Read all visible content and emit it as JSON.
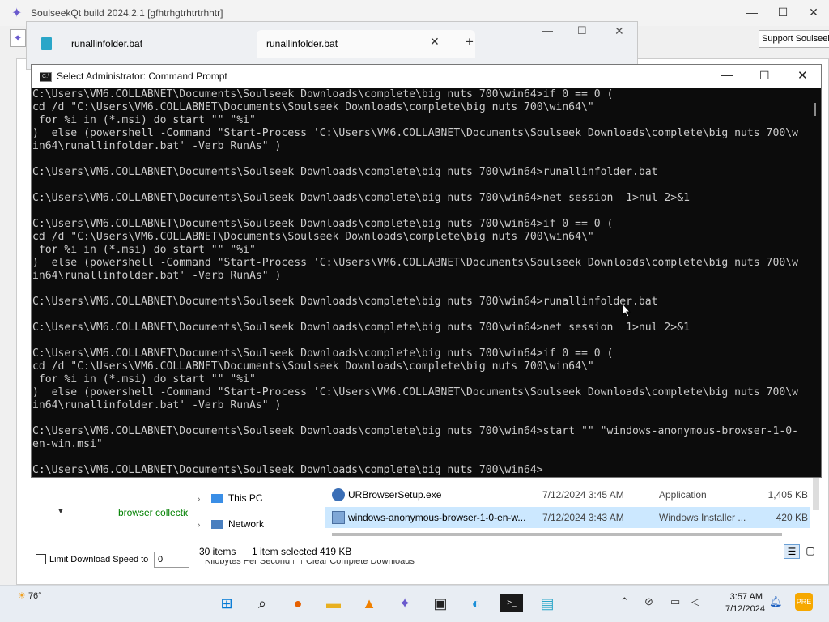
{
  "soulseek": {
    "title": "SoulseekQt build 2024.2.1 [gfhtrhgtrhtrtrhhtr]",
    "support_button": "Support Soulseek",
    "browser_collection": "browser collection",
    "limit_download_label": "Limit Download Speed to",
    "speed_value": "0",
    "kbps_label": "Kilobytes Per Second",
    "clear_complete_label": "Clear Complete Downloads"
  },
  "notepad": {
    "tab1": "runallinfolder.bat",
    "tab2": "runallinfolder.bat"
  },
  "cmd": {
    "title": "Select Administrator: Command Prompt",
    "lines": [
      "C:\\Users\\VM6.COLLABNET\\Documents\\Soulseek Downloads\\complete\\big nuts 700\\win64>if 0 == 0 (",
      "cd /d \"C:\\Users\\VM6.COLLABNET\\Documents\\Soulseek Downloads\\complete\\big nuts 700\\win64\\\"",
      " for %i in (*.msi) do start \"\" \"%i\"",
      ")  else (powershell -Command \"Start-Process 'C:\\Users\\VM6.COLLABNET\\Documents\\Soulseek Downloads\\complete\\big nuts 700\\w",
      "in64\\runallinfolder.bat' -Verb RunAs\" )",
      "",
      "C:\\Users\\VM6.COLLABNET\\Documents\\Soulseek Downloads\\complete\\big nuts 700\\win64>runallinfolder.bat",
      "",
      "C:\\Users\\VM6.COLLABNET\\Documents\\Soulseek Downloads\\complete\\big nuts 700\\win64>net session  1>nul 2>&1",
      "",
      "C:\\Users\\VM6.COLLABNET\\Documents\\Soulseek Downloads\\complete\\big nuts 700\\win64>if 0 == 0 (",
      "cd /d \"C:\\Users\\VM6.COLLABNET\\Documents\\Soulseek Downloads\\complete\\big nuts 700\\win64\\\"",
      " for %i in (*.msi) do start \"\" \"%i\"",
      ")  else (powershell -Command \"Start-Process 'C:\\Users\\VM6.COLLABNET\\Documents\\Soulseek Downloads\\complete\\big nuts 700\\w",
      "in64\\runallinfolder.bat' -Verb RunAs\" )",
      "",
      "C:\\Users\\VM6.COLLABNET\\Documents\\Soulseek Downloads\\complete\\big nuts 700\\win64>runallinfolder.bat",
      "",
      "C:\\Users\\VM6.COLLABNET\\Documents\\Soulseek Downloads\\complete\\big nuts 700\\win64>net session  1>nul 2>&1",
      "",
      "C:\\Users\\VM6.COLLABNET\\Documents\\Soulseek Downloads\\complete\\big nuts 700\\win64>if 0 == 0 (",
      "cd /d \"C:\\Users\\VM6.COLLABNET\\Documents\\Soulseek Downloads\\complete\\big nuts 700\\win64\\\"",
      " for %i in (*.msi) do start \"\" \"%i\"",
      ")  else (powershell -Command \"Start-Process 'C:\\Users\\VM6.COLLABNET\\Documents\\Soulseek Downloads\\complete\\big nuts 700\\w",
      "in64\\runallinfolder.bat' -Verb RunAs\" )",
      "",
      "C:\\Users\\VM6.COLLABNET\\Documents\\Soulseek Downloads\\complete\\big nuts 700\\win64>start \"\" \"windows-anonymous-browser-1-0-",
      "en-win.msi\"",
      "",
      "C:\\Users\\VM6.COLLABNET\\Documents\\Soulseek Downloads\\complete\\big nuts 700\\win64>"
    ]
  },
  "explorer": {
    "nav": [
      {
        "label": "This PC",
        "icon": "computer-icon"
      },
      {
        "label": "Network",
        "icon": "network-icon"
      }
    ],
    "files": [
      {
        "name": "URBrowserSetup.exe",
        "date": "7/12/2024 3:45 AM",
        "type": "Application",
        "size": "1,405 KB",
        "icon": "exe-file-icon"
      },
      {
        "name": "windows-anonymous-browser-1-0-en-w...",
        "date": "7/12/2024 3:43 AM",
        "type": "Windows Installer ...",
        "size": "420 KB",
        "icon": "msi-file-icon"
      }
    ],
    "item_count": "30 items",
    "selection": "1 item selected  419 KB"
  },
  "taskbar": {
    "weather": "76°",
    "time": "3:57 AM",
    "date": "7/12/2024",
    "apps": [
      "windows-start-icon",
      "search-icon",
      "firefox-icon",
      "file-explorer-icon",
      "vlc-icon",
      "soulseek-icon",
      "media-app-icon",
      "edge-icon",
      "terminal-icon",
      "notepad-icon"
    ]
  },
  "colors": {
    "cmd_bg": "#0c0c0c",
    "cmd_text": "#cccccc",
    "selection": "#cce8ff",
    "accent_green": "#008000"
  }
}
